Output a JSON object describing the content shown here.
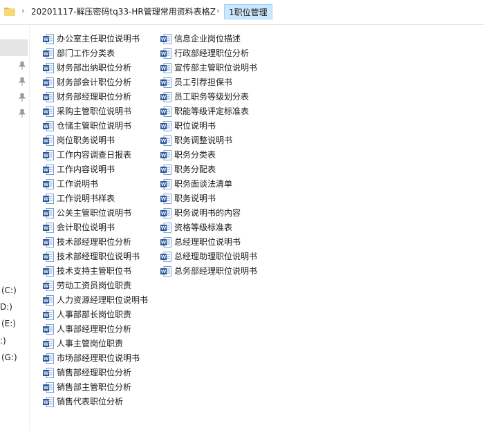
{
  "breadcrumb": {
    "parent": "20201117-解压密码tq33-HR管理常用资料表格Z",
    "current": "1职位管理"
  },
  "nav": {
    "drives": [
      "(C:)",
      "D:)",
      "(E:)",
      ":)",
      "(G:)"
    ]
  },
  "files": {
    "column1": [
      "办公室主任职位说明书",
      "部门工作分类表",
      "财务部出纳职位分析",
      "财务部会计职位分析",
      "财务部经理职位分析",
      "采购主管职位说明书",
      "仓储主管职位说明书",
      "岗位职务说明书",
      "工作内容调查日报表",
      "工作内容说明书",
      "工作说明书",
      "工作说明书样表",
      "公关主管职位说明书",
      "会计职位说明书",
      "技术部经理职位分析",
      "技术部经理职位说明书",
      "技术支持主管职位书",
      "劳动工资员岗位职责",
      "人力资源经理职位说明书",
      "人事部部长岗位职责",
      "人事部经理职位分析",
      "人事主管岗位职责",
      "市场部经理职位说明书",
      "销售部经理职位分析",
      "销售部主管职位分析",
      "销售代表职位分析"
    ],
    "column2": [
      "信息企业岗位描述",
      "行政部经理职位分析",
      "宣传部主管职位说明书",
      "员工引荐担保书",
      "员工职务等级划分表",
      "职能等级评定标准表",
      "职位说明书",
      "职务调整说明书",
      "职务分类表",
      "职务分配表",
      "职务面谈法清单",
      "职务说明书",
      "职务说明书的内容",
      "资格等级标准表",
      "总经理职位说明书",
      "总经理助理职位说明书",
      "总务部经理职位说明书"
    ]
  },
  "colors": {
    "word_blue": "#2b579a",
    "selection": "#cce8ff",
    "folder_yellow": "#f8d775"
  }
}
